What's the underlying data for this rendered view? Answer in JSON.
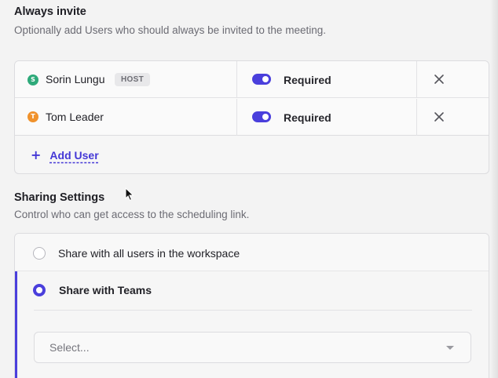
{
  "always_invite": {
    "title": "Always invite",
    "description": "Optionally add Users who should always be invited to the meeting.",
    "users": [
      {
        "name": "Sorin Lungu",
        "initial": "S",
        "avatar_color": "#2eaa7a",
        "badge": "HOST",
        "toggle_on": true,
        "toggle_label": "Required",
        "remove_icon": "close-icon"
      },
      {
        "name": "Tom Leader",
        "initial": "T",
        "avatar_color": "#f0922c",
        "badge": "",
        "toggle_on": true,
        "toggle_label": "Required",
        "remove_icon": "close-icon"
      }
    ],
    "add_user_label": "Add User",
    "add_user_icon": "plus-icon"
  },
  "sharing_settings": {
    "title": "Sharing Settings",
    "description": "Control who can get access to the scheduling link.",
    "options": [
      {
        "label": "Share with all users in the workspace",
        "selected": false
      },
      {
        "label": "Share with Teams",
        "selected": true
      }
    ],
    "teams_select": {
      "placeholder": "Select...",
      "icon": "chevron-down-icon"
    }
  },
  "colors": {
    "accent": "#4a3fdc",
    "link": "#4438d6"
  }
}
